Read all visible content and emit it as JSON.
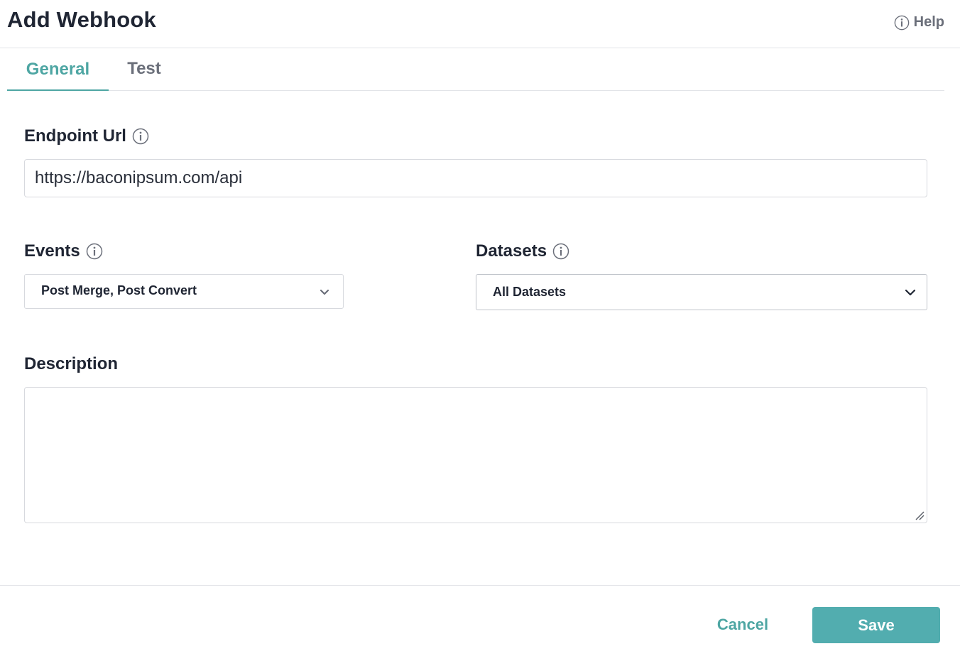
{
  "header": {
    "title": "Add Webhook",
    "help_label": "Help"
  },
  "tabs": [
    {
      "label": "General",
      "active": true
    },
    {
      "label": "Test",
      "active": false
    }
  ],
  "form": {
    "endpoint": {
      "label": "Endpoint Url",
      "value": "https://baconipsum.com/api"
    },
    "events": {
      "label": "Events",
      "selected": "Post Merge, Post Convert"
    },
    "datasets": {
      "label": "Datasets",
      "selected": "All Datasets"
    },
    "description": {
      "label": "Description",
      "value": ""
    }
  },
  "footer": {
    "cancel_label": "Cancel",
    "save_label": "Save"
  },
  "colors": {
    "accent": "#4ea6a3",
    "save_button": "#52adaf",
    "text": "#1f2533",
    "muted": "#6b6f7a"
  },
  "icons": {
    "info": "info-circle-icon",
    "chevron": "chevron-down-icon",
    "resize": "resize-handle-icon"
  }
}
